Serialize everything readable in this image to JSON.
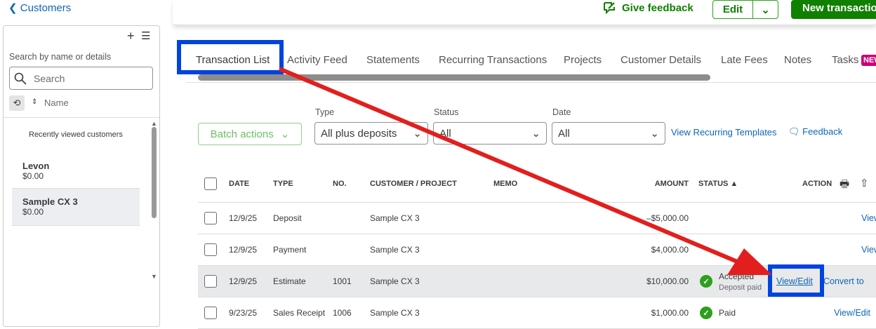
{
  "header": {
    "back_label": "Customers",
    "feedback_label": "Give feedback",
    "edit_label": "Edit",
    "new_transaction_label": "New transaction"
  },
  "sidebar": {
    "search_label": "Search by name or details",
    "search_placeholder": "Search",
    "sort_label": "Name",
    "recent_label": "Recently viewed customers",
    "customers": [
      {
        "name": "Levon",
        "balance": "$0.00"
      },
      {
        "name": "Sample CX 3",
        "balance": "$0.00"
      }
    ]
  },
  "tabs": [
    "Transaction List",
    "Activity Feed",
    "Statements",
    "Recurring Transactions",
    "Projects",
    "Customer Details",
    "Late Fees",
    "Notes",
    "Tasks"
  ],
  "tasks_badge": "NEW",
  "filters": {
    "batch_label": "Batch actions",
    "type_label": "Type",
    "type_value": "All plus deposits",
    "status_label": "Status",
    "status_value": "All",
    "date_label": "Date",
    "date_value": "All",
    "recurring_link": "View Recurring Templates",
    "feedback_link": "Feedback"
  },
  "table": {
    "headers": {
      "date": "DATE",
      "type": "TYPE",
      "no": "NO.",
      "customer": "CUSTOMER / PROJECT",
      "memo": "MEMO",
      "amount": "AMOUNT",
      "status": "STATUS ▲",
      "action": "ACTION"
    },
    "rows": [
      {
        "date": "12/9/25",
        "type": "Deposit",
        "no": "",
        "customer": "Sample CX 3",
        "amount": "–$5,000.00",
        "status": "",
        "status_sub": "",
        "action": "View",
        "action2": ""
      },
      {
        "date": "12/9/25",
        "type": "Payment",
        "no": "",
        "customer": "Sample CX 3",
        "amount": "$4,000.00",
        "status": "",
        "status_sub": "",
        "action": "View",
        "action2": ""
      },
      {
        "date": "12/9/25",
        "type": "Estimate",
        "no": "1001",
        "customer": "Sample CX 3",
        "amount": "$10,000.00",
        "status": "Accepted",
        "status_sub": "Deposit paid",
        "action": "View/Edit",
        "action2": "Convert to"
      },
      {
        "date": "9/23/25",
        "type": "Sales Receipt",
        "no": "1006",
        "customer": "Sample CX 3",
        "amount": "$1,000.00",
        "status": "Paid",
        "status_sub": "",
        "action": "View/Edit",
        "action2": ""
      }
    ]
  },
  "colors": {
    "accent_green": "#108000",
    "link_blue": "#0d66b7",
    "annotation_blue": "#0044dd",
    "annotation_red": "#e31e1e"
  }
}
